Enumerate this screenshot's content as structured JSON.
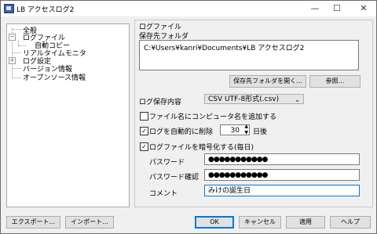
{
  "window": {
    "title": "LB アクセスログ2",
    "minimize": "—",
    "maximize": "☐",
    "close": "✕"
  },
  "tree": {
    "items": [
      {
        "label": "全般"
      },
      {
        "label": "ログファイル",
        "expanded": true
      },
      {
        "label": "自動コピー"
      },
      {
        "label": "リアルタイムモニタ"
      },
      {
        "label": "ログ設定",
        "expanded": false
      },
      {
        "label": "バージョン情報"
      },
      {
        "label": "オープンソース情報"
      }
    ]
  },
  "panel": {
    "title": "ログファイル",
    "save_folder_label": "保存先フォルダ",
    "save_folder_value": "C:¥Users¥kanri¥Documents¥LB アクセスログ2",
    "open_folder_button": "保存先フォルダを開く...",
    "browse_button": "参照...",
    "content_label": "ログ保存内容",
    "content_value": "CSV UTF-8形式(.csv)",
    "opt_add_computer_name": {
      "label": "ファイル名にコンピュータ名を追加する",
      "checked": false
    },
    "opt_auto_delete": {
      "label": "ログを自動的に削除",
      "checked": true
    },
    "days_value": "30",
    "days_unit": "日後",
    "opt_encrypt": {
      "label": "ログファイルを暗号化する(毎日)",
      "checked": true
    },
    "password_label": "パスワード",
    "password_value": "●●●●●●●●●●●",
    "password_confirm_label": "パスワード確認",
    "password_confirm_value": "●●●●●●●●●●●",
    "comment_label": "コメント",
    "comment_value": "みけの誕生日"
  },
  "footer": {
    "export": "エクスポート...",
    "import": "インポート...",
    "ok": "OK",
    "cancel": "キャンセル",
    "apply": "適用",
    "help": "ヘルプ"
  },
  "colors": {
    "accent": "#0078d7",
    "background": "#f0f0f0"
  }
}
